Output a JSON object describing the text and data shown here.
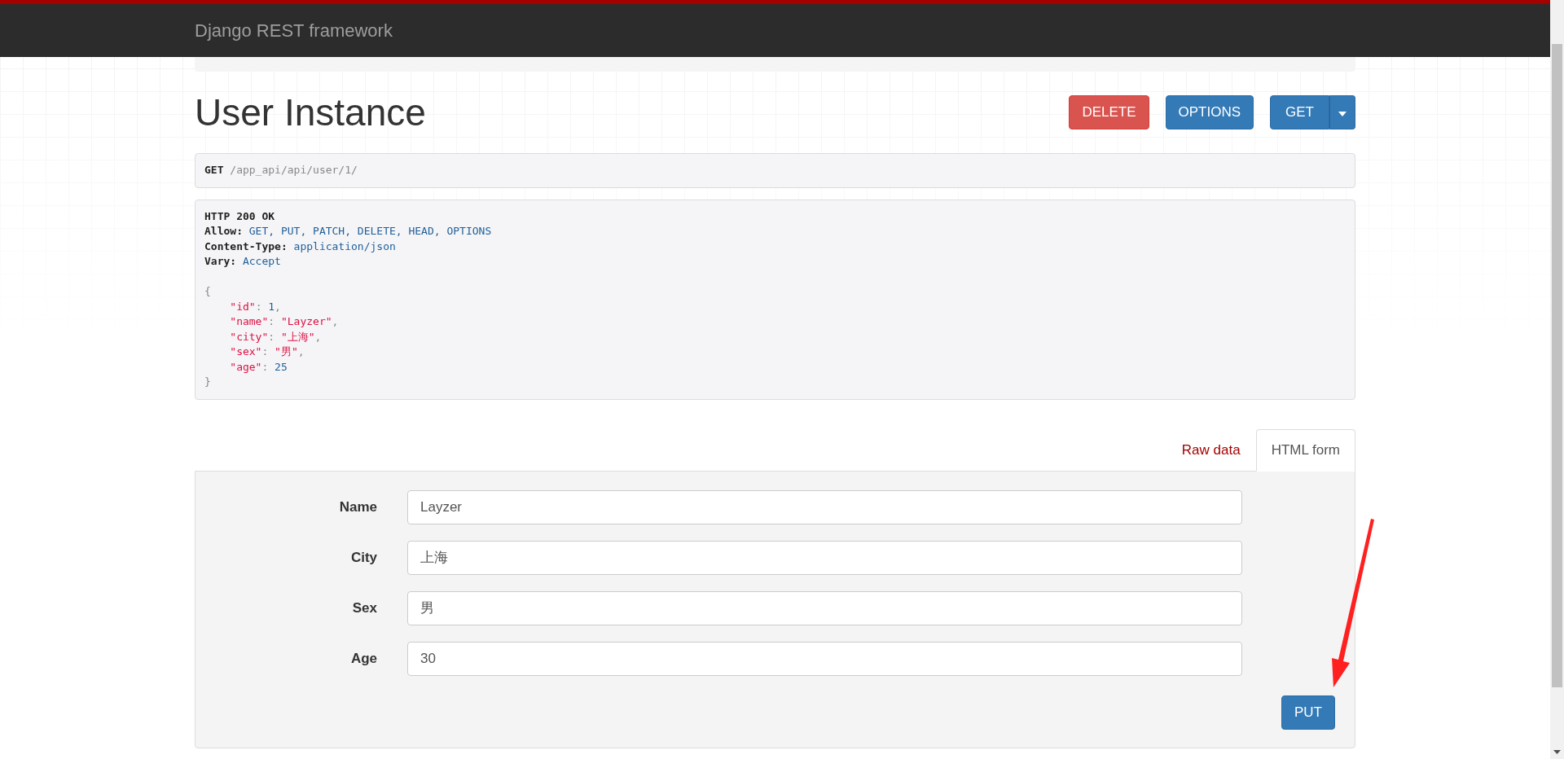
{
  "navbar": {
    "brand": "Django REST framework"
  },
  "page": {
    "title": "User Instance"
  },
  "actions": [
    {
      "label": "DELETE",
      "kind": "danger"
    },
    {
      "label": "OPTIONS",
      "kind": "primary"
    },
    {
      "label": "GET",
      "kind": "split"
    }
  ],
  "request": {
    "method": "GET",
    "path": "/app_api/api/user/1/"
  },
  "response": {
    "status": "HTTP 200 OK",
    "headers": [
      {
        "name": "Allow:",
        "value": "GET, PUT, PATCH, DELETE, HEAD, OPTIONS"
      },
      {
        "name": "Content-Type:",
        "value": "application/json"
      },
      {
        "name": "Vary:",
        "value": "Accept"
      }
    ],
    "open": "{",
    "body": [
      [
        {
          "text": "\"id\"",
          "kind": "key"
        },
        {
          "text": ":",
          "kind": "punct"
        },
        {
          "text": "1",
          "kind": "number"
        },
        {
          "text": ",",
          "kind": "punct"
        }
      ],
      [
        {
          "text": "\"name\"",
          "kind": "key"
        },
        {
          "text": ":",
          "kind": "punct"
        },
        {
          "text": "\"Layzer\"",
          "kind": "string"
        },
        {
          "text": ",",
          "kind": "punct"
        }
      ],
      [
        {
          "text": "\"city\"",
          "kind": "key"
        },
        {
          "text": ":",
          "kind": "punct"
        },
        {
          "text": "\"上海\"",
          "kind": "string"
        },
        {
          "text": ",",
          "kind": "punct"
        }
      ],
      [
        {
          "text": "\"sex\"",
          "kind": "key"
        },
        {
          "text": ":",
          "kind": "punct"
        },
        {
          "text": "\"男\"",
          "kind": "string"
        },
        {
          "text": ",",
          "kind": "punct"
        }
      ],
      [
        {
          "text": "\"age\"",
          "kind": "key"
        },
        {
          "text": ":",
          "kind": "punct"
        },
        {
          "text": "25",
          "kind": "number"
        }
      ]
    ],
    "close": "}"
  },
  "tabs": [
    {
      "label": "Raw data",
      "selected": false
    },
    {
      "label": "HTML form",
      "selected": true
    }
  ],
  "form": {
    "fields": [
      {
        "label": "Name",
        "value": "Layzer"
      },
      {
        "label": "City",
        "value": "上海"
      },
      {
        "label": "Sex",
        "value": "男"
      },
      {
        "label": "Age",
        "value": "30"
      }
    ],
    "submit": "PUT"
  }
}
